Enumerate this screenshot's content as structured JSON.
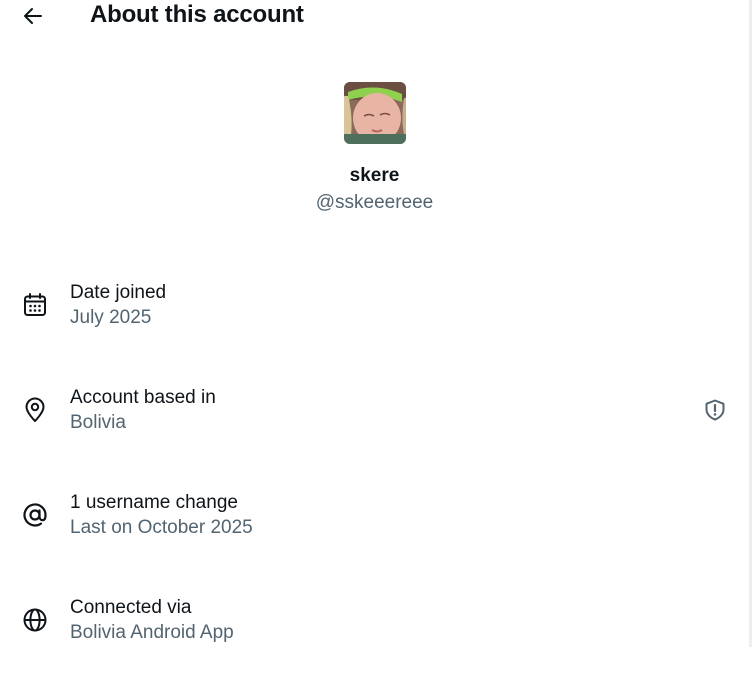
{
  "header": {
    "title": "About this account",
    "back_icon": "arrow-left-icon"
  },
  "profile": {
    "display_name": "skere",
    "handle": "@sskeeereee",
    "avatar_alt": "Profile photo"
  },
  "items": [
    {
      "icon": "calendar-icon",
      "label": "Date joined",
      "value": "July 2025"
    },
    {
      "icon": "location-pin-icon",
      "label": "Account based in",
      "value": "Bolivia",
      "trailing_icon": "shield-alert-icon"
    },
    {
      "icon": "at-sign-icon",
      "label": "1 username change",
      "value": "Last on October 2025"
    },
    {
      "icon": "globe-icon",
      "label": "Connected via",
      "value": "Bolivia Android App"
    }
  ],
  "colors": {
    "primary_text": "#0f1419",
    "secondary_text": "#536471",
    "background": "#ffffff"
  }
}
